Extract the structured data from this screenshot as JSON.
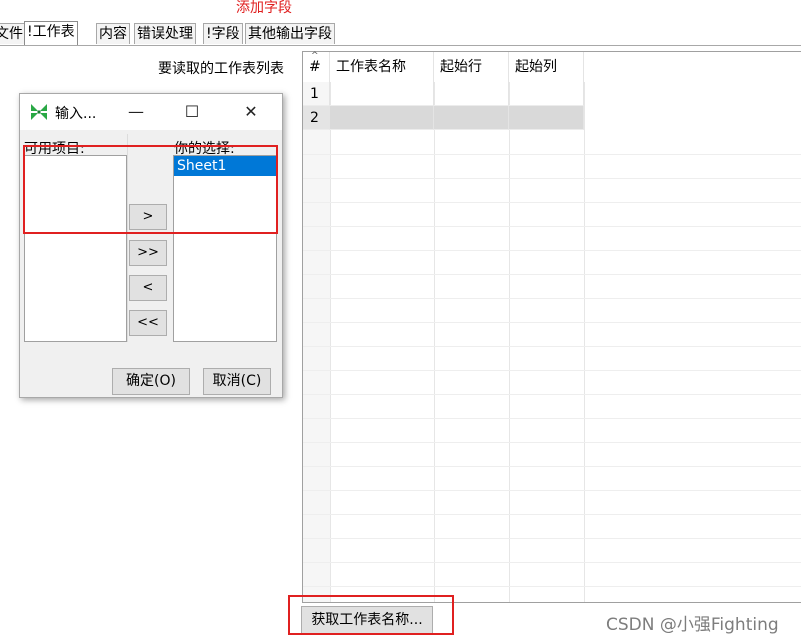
{
  "annotation_title": "添加字段",
  "tabs": [
    {
      "label": "文件"
    },
    {
      "label": "!工作表",
      "active": true
    },
    {
      "label": "内容"
    },
    {
      "label": "错误处理"
    },
    {
      "label": "!字段"
    },
    {
      "label": "其他输出字段"
    }
  ],
  "sheet_list_label": "要读取的工作表列表",
  "table": {
    "columns": [
      "#",
      "工作表名称",
      "起始行",
      "起始列"
    ],
    "rows": [
      {
        "num": "1",
        "name": "",
        "start_row": "",
        "start_col": ""
      },
      {
        "num": "2",
        "name": "",
        "start_row": "",
        "start_col": "",
        "selected": true
      }
    ]
  },
  "get_sheet_names_button": "获取工作表名称...",
  "watermark": "CSDN @小强Fighting",
  "dialog": {
    "title": "输入...",
    "app_icon": "kettle-spoon-icon",
    "minimize": "—",
    "maximize": "☐",
    "close": "✕",
    "available_label": "可用项目:",
    "selected_label": "你的选择:",
    "available_items": [],
    "selected_items": [
      "Sheet1"
    ],
    "move_buttons": [
      ">",
      ">>",
      "<",
      "<<"
    ],
    "ok_button": "确定(O)",
    "cancel_button": "取消(C)"
  },
  "colors": {
    "annotation_red": "#e02020",
    "selection_blue": "#0078d7"
  }
}
